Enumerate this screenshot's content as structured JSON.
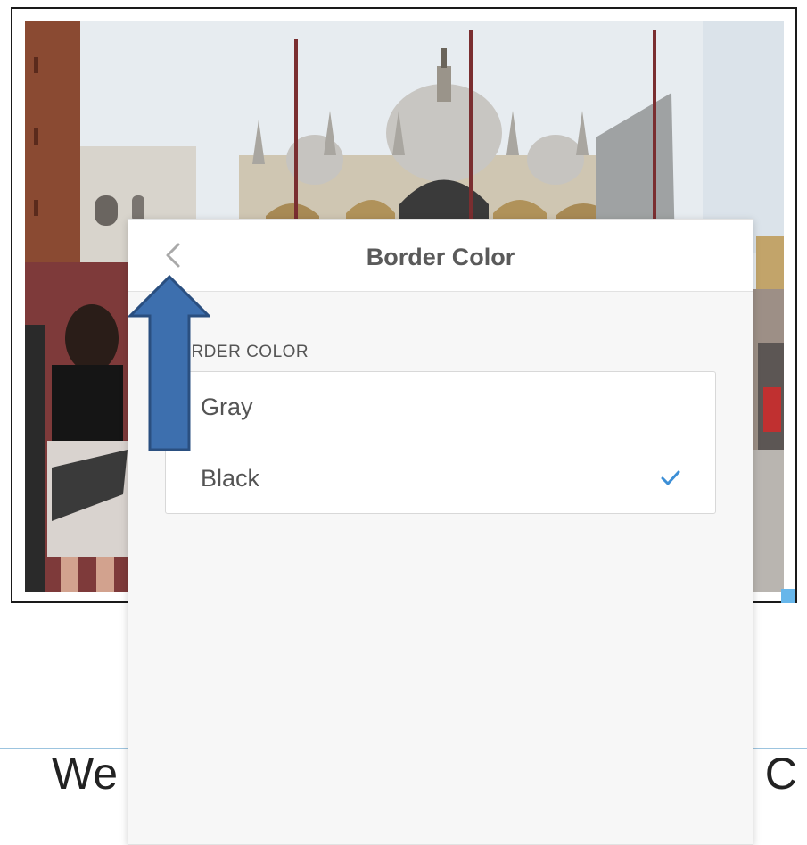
{
  "popover": {
    "title": "Border Color",
    "back_icon": "chevron-left-icon",
    "section_label": "BORDER COLOR",
    "options": [
      {
        "label": "Gray",
        "selected": false
      },
      {
        "label": "Black",
        "selected": true
      }
    ],
    "check_icon": "checkmark-icon",
    "check_color": "#3d8fd6"
  },
  "document": {
    "text_left": "We",
    "text_right": "e C"
  },
  "colors": {
    "annotation_arrow": "#3d6fae",
    "selection_handle": "#67b6ea"
  }
}
